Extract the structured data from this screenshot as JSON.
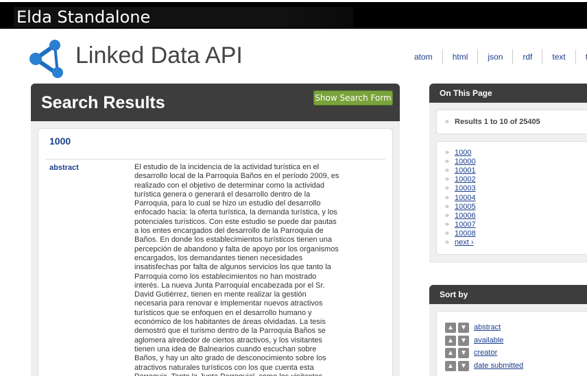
{
  "window": {
    "title": "Elda Standalone"
  },
  "header": {
    "title": "Linked Data API",
    "formats": [
      "atom",
      "html",
      "json",
      "rdf",
      "text",
      "ttl"
    ]
  },
  "results": {
    "heading": "Search Results",
    "show_form_label": "Show Search Form",
    "item": {
      "label": "1000",
      "property": "abstract",
      "value": "El estudio de la incidencia de la actividad turística en el desarrollo local de la Parroquia Baños en el período 2009, es realizado con el objetivo de determinar como la actividad turística genera o generará el desarrollo dentro de la Parroquia, para lo cual se hizo un estudio del desarrollo enfocado hacia: la oferta turística, la demanda turística, y los potenciales turísticos. Con este estudio se puede dar pautas a los entes encargados del desarrollo de la Parroquia de Baños. En donde los establecimientos turísticos tienen una percepción de abandono y falta de apoyo por los organismos encargados, los demandantes tienen necesidades insatisfechas por falta de algunos servicios los que tanto la Parroquia como los establecimientos no han mostrado interés. La nueva Junta Parroquial encabezada por el Sr. David Gutiérrez, tienen en mente realizar la gestión necesaria para renovar e implementar nuevos atractivos turísticos que se enfoquen en el desarrollo humano y económico de los habitantes de áreas olvidadas. La tesis demostró que el turismo dentro de la Parroquia Baños se aglomera alrededor de ciertos atractivos, y los visitantes tienen una idea de Balnearios cuando escuchan sobre Baños, y hay un alto grado de desconocimiento sobre los atractivos naturales turísticos con los que cuenta esta Parroquia. Tanto la Junta Parroquial, como los visitantes"
    }
  },
  "on_this_page": {
    "heading": "On This Page",
    "summary": "Results 1 to 10 of 25405",
    "items": [
      "1000",
      "10000",
      "10001",
      "10002",
      "10003",
      "10004",
      "10005",
      "10006",
      "10007",
      "10008",
      "next ›"
    ]
  },
  "sort_by": {
    "heading": "Sort by",
    "items": [
      "abstract",
      "available",
      "creator",
      "date submitted"
    ]
  },
  "colors": {
    "accent": "#7aa33b",
    "panel_header": "#3d3d3d",
    "link": "#1a3e8c"
  },
  "icons": {
    "logo": "network-nodes-icon",
    "bullet": "chevron-right-icon",
    "sort_up": "chevron-up-icon",
    "sort_down": "chevron-down-icon"
  }
}
